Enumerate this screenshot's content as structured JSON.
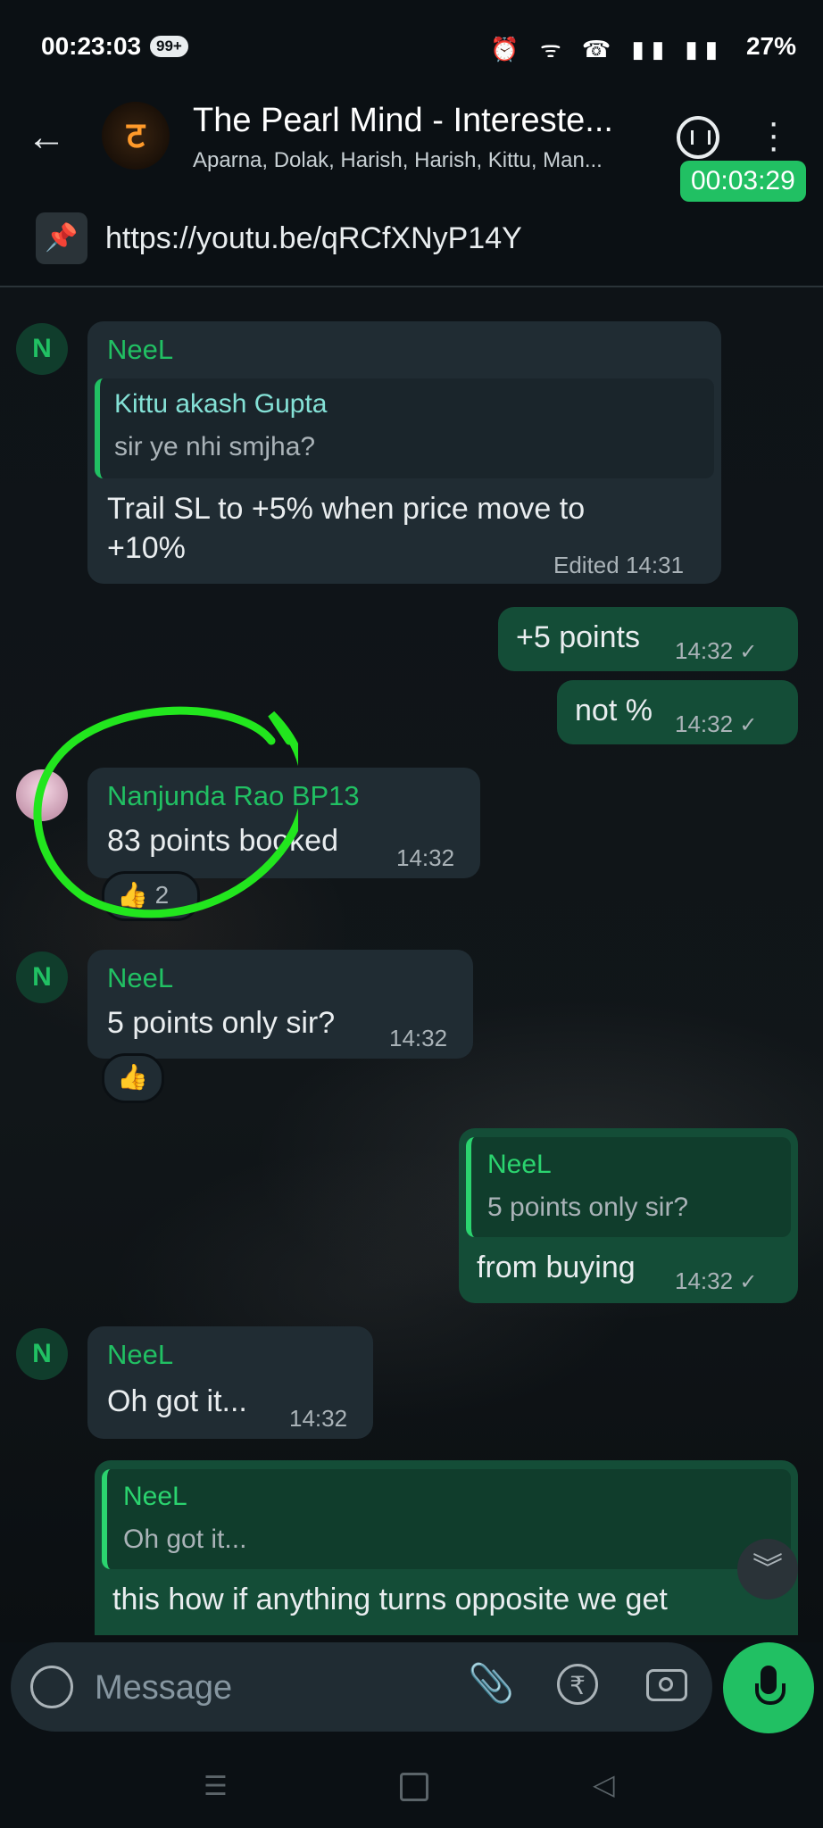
{
  "status_bar": {
    "time": "00:23:03",
    "notif_badge": "99+",
    "battery": "27%"
  },
  "header": {
    "title": "The Pearl Mind - Intereste...",
    "subtitle": "Aparna, Dolak, Harish, Harish, Kittu, Man...",
    "avatar_glyph": "ट",
    "call_timer": "00:03:29"
  },
  "pinned": {
    "link": "https://youtu.be/qRCfXNyP14Y"
  },
  "messages": [
    {
      "sender": "NeeL",
      "quote_name": "Kittu akash Gupta",
      "quote_text": "sir ye nhi smjha?",
      "text_line1": "Trail SL to +5% when price move to",
      "text_line2": "+10%",
      "meta_edited": "Edited",
      "meta_time": "14:31",
      "avatar": "N"
    },
    {
      "text": "+5 points",
      "time": "14:32"
    },
    {
      "text": "not %",
      "time": "14:32"
    },
    {
      "sender": "Nanjunda Rao BP13",
      "text": "83 points booked",
      "time": "14:32",
      "reaction_emoji": "👍",
      "reaction_count": "2"
    },
    {
      "sender": "NeeL",
      "text": "5 points only sir?",
      "time": "14:32",
      "reaction_emoji": "👍",
      "avatar": "N"
    },
    {
      "quote_name": "NeeL",
      "quote_text": "5 points only sir?",
      "text": "from buying",
      "time": "14:32"
    },
    {
      "sender": "NeeL",
      "text": "Oh got it...",
      "time": "14:32",
      "avatar": "N"
    },
    {
      "quote_name": "NeeL",
      "quote_text": "Oh got it...",
      "text": "this how if anything turns opposite we get"
    }
  ],
  "compose": {
    "placeholder": "Message"
  },
  "colors": {
    "accent": "#21c063",
    "incoming": "#202c33",
    "outgoing": "#144d37",
    "annotation": "#22e61e"
  }
}
